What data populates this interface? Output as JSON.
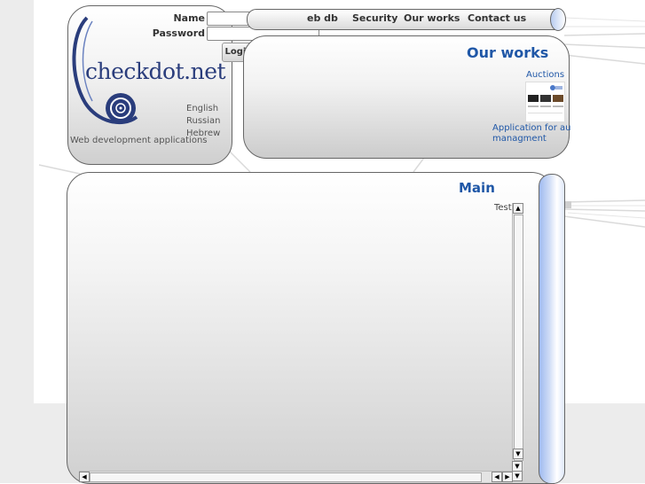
{
  "login": {
    "name_label": "Name",
    "password_label": "Password",
    "name_value": "",
    "password_value": "",
    "login_button": "Login"
  },
  "logo": {
    "text": "checkdot.net"
  },
  "languages": [
    "English",
    "Russian",
    "Hebrew"
  ],
  "tagline": "Web development applications",
  "nav": {
    "items": [
      "eb db",
      "Security",
      "Our works",
      "Contact us"
    ]
  },
  "works": {
    "title": "Our works",
    "items": [
      {
        "label": "Auctions"
      },
      {
        "label_line1": "Application for au",
        "label_line2": "managment"
      }
    ]
  },
  "main": {
    "title": "Main",
    "content_text": "Test"
  },
  "colors": {
    "link_blue": "#1f57a7",
    "logo_blue": "#2a3d7c",
    "cap_blue": "#9fbaf0"
  },
  "icons": {
    "logo": "swirl-target-logo",
    "scroll_up": "arrow-up",
    "scroll_down": "arrow-down",
    "scroll_left": "arrow-left",
    "scroll_right": "arrow-right"
  }
}
